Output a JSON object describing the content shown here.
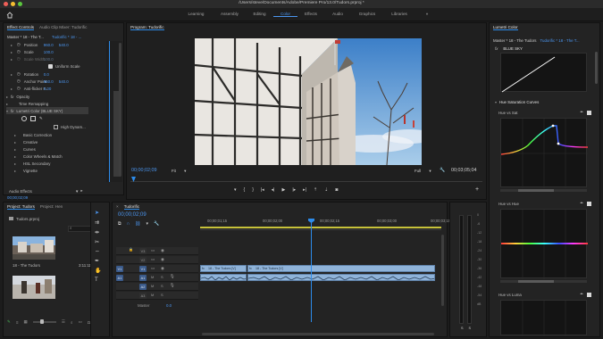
{
  "titlebar": {
    "path": "/Users/steve/Documents/Adobe/Premiere Pro/13.0/Tudors.prproj *"
  },
  "workspaces": {
    "items": [
      "Learning",
      "Assembly",
      "Editing",
      "Color",
      "Effects",
      "Audio",
      "Graphics",
      "Libraries"
    ],
    "active": "Color",
    "more": "»"
  },
  "effect_controls": {
    "tabs": [
      "Effect Controls",
      "Audio Clip Mixer: Tudorific"
    ],
    "clip_master": "Master * 18 - The T...",
    "clip_seq": "Tudorific * 18 - ...",
    "rows": [
      {
        "label": "Position",
        "v1": "960.0",
        "v2": "540.0"
      },
      {
        "label": "Scale",
        "v1": "100.0",
        "v2": ""
      },
      {
        "label": "Scale Width",
        "v1": "100.0",
        "v2": ""
      },
      {
        "label": "Uniform Scale",
        "v1": "",
        "v2": ""
      },
      {
        "label": "Rotation",
        "v1": "0.0",
        "v2": ""
      },
      {
        "label": "Anchor Point",
        "v1": "960.0",
        "v2": "540.0"
      },
      {
        "label": "Anti-flicker F...",
        "v1": "0.00",
        "v2": ""
      }
    ],
    "sections": [
      "Opacity",
      "Time Remapping",
      "Lumetri Color (BLUE SKY)"
    ],
    "high_dynamic": "High Dynam...",
    "lumetri_items": [
      "Basic Correction",
      "Creative",
      "Curves",
      "Color Wheels & Match",
      "HSL Secondary",
      "Vignette"
    ],
    "audio_effects": "Audio Effects",
    "timecode": "00;00;02;09"
  },
  "program": {
    "title": "Program: Tudorific",
    "timecode_in": "00;00;02;09",
    "fit": "Fit",
    "quality": "Full",
    "timecode_out": "00;03;05;04"
  },
  "lumetri": {
    "title": "Lumetri Color",
    "master": "Master * 18 - The Tudors",
    "seq": "Tudorific * 18 - The T...",
    "fx_label": "fx",
    "preset": "BLUE SKY",
    "section": "Hue Saturation Curves",
    "curves": [
      "Hue vs Sat",
      "Hue vs Hue",
      "Hue vs Luma"
    ]
  },
  "project": {
    "tabs": [
      "Project: Tudors",
      "Project: Hen"
    ],
    "file": "Tudors.prproj",
    "clips": [
      {
        "name": "18 - The Tudors",
        "duration": "3:11:11"
      }
    ]
  },
  "timeline": {
    "title": "Tudorific",
    "timecode": "00;00;02;09",
    "ruler": [
      "00;00;01;15",
      "00;00;02;00",
      "00;00;02;15",
      "00;00;03;00",
      "00;00;03;15"
    ],
    "tracks": [
      {
        "target": "",
        "name": "V3"
      },
      {
        "target": "",
        "name": "V2"
      },
      {
        "target": "V1",
        "name": "V1"
      },
      {
        "target": "A1",
        "name": "A1"
      },
      {
        "target": "",
        "name": "A2"
      },
      {
        "target": "",
        "name": "A3"
      }
    ],
    "master_label": "Master",
    "master_value": "0.0",
    "clip_a": "18 - The Tudors [V]",
    "clip_b": "18 - The Tudors [V]",
    "meter_labels": [
      "0",
      "-6",
      "-12",
      "-18",
      "-24",
      "-30",
      "-36",
      "-42",
      "-48",
      "-54",
      "dB"
    ],
    "solo_labels": [
      "S",
      "S"
    ]
  }
}
